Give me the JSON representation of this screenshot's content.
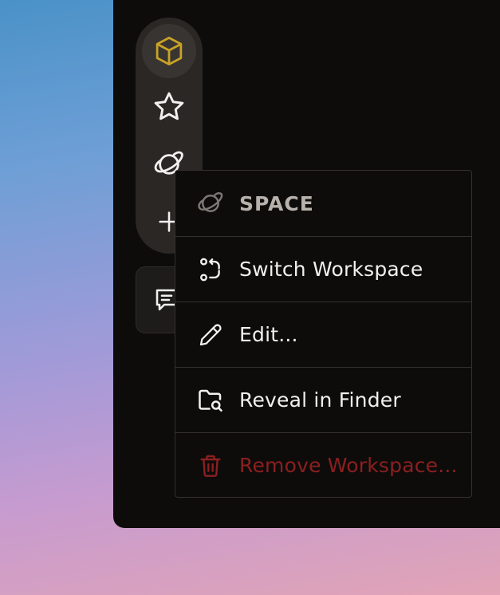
{
  "rail": {
    "items": [
      {
        "icon": "cube-icon",
        "active": true,
        "color": "#c9a227"
      },
      {
        "icon": "star-icon",
        "active": false
      },
      {
        "icon": "planet-icon",
        "active": false
      },
      {
        "icon": "plus-icon",
        "active": false
      }
    ],
    "notes_icon": "message-square-icon"
  },
  "context_menu": {
    "header": {
      "label": "SPACE",
      "icon": "planet-icon"
    },
    "items": [
      {
        "label": "Switch Workspace",
        "icon": "switch-icon"
      },
      {
        "label": "Edit...",
        "icon": "pencil-icon"
      },
      {
        "label": "Reveal in Finder",
        "icon": "folder-search-icon"
      },
      {
        "label": "Remove Workspace...",
        "icon": "trash-icon",
        "danger": true,
        "color": "#8c1f1f"
      }
    ]
  }
}
